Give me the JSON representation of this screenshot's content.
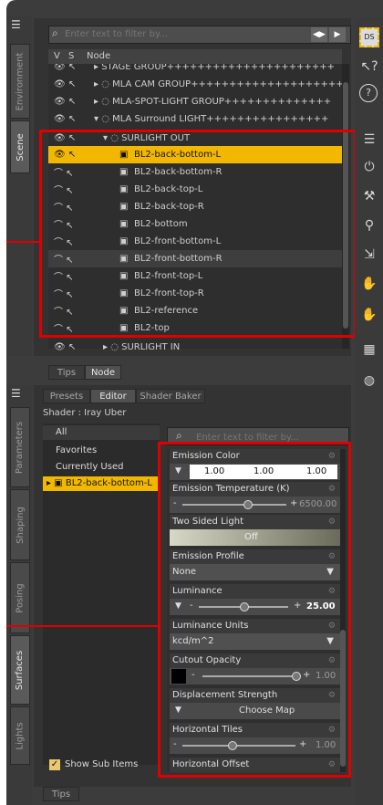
{
  "side_tabs_top": [
    "Environment",
    "Scene"
  ],
  "side_tabs_bottom": [
    "Parameters",
    "Shaping",
    "Posing",
    "Surfaces",
    "Lights"
  ],
  "scene": {
    "filter_placeholder": "Enter text to filter by...",
    "col_v": "V",
    "col_s": "S",
    "col_node": "Node",
    "groups_above": [
      "STAGE GROUP++++++++++++++++++++++",
      "MLA CAM GROUP++++++++++++++++++++",
      "MLA-SPOT-LIGHT GROUP++++++++++++++",
      "MLA Surround LIGHT++++++++++++++++"
    ],
    "group_open": "SURLIGHT OUT",
    "items": [
      "BL2-back-bottom-L",
      "BL2-back-bottom-R",
      "BL2-back-top-L",
      "BL2-back-top-R",
      "BL2-bottom",
      "BL2-front-bottom-L",
      "BL2-front-bottom-R",
      "BL2-front-top-L",
      "BL2-front-top-R",
      "BL2-reference",
      "BL2-top"
    ],
    "group_below": "SURLIGHT IN",
    "bottom_tabs": [
      "Tips",
      "Node"
    ]
  },
  "surfaces": {
    "tabs": [
      "Presets",
      "Editor",
      "Shader Baker"
    ],
    "shader": "Shader : Iray Uber",
    "left_list": [
      "All",
      "Favorites",
      "Currently Used",
      "BL2-back-bottom-L"
    ],
    "filter_placeholder": "Enter text to filter by...",
    "show_sub_items": "Show Sub Items",
    "bottom_tab": "Tips",
    "props": {
      "emission_color": "Emission Color",
      "emission_color_values": [
        "1.00",
        "1.00",
        "1.00"
      ],
      "emission_temp": "Emission Temperature (K)",
      "emission_temp_value": "6500.00",
      "emission_temp_fraction": 0.62,
      "two_sided": "Two Sided Light",
      "two_sided_value": "Off",
      "emission_profile": "Emission Profile",
      "emission_profile_value": "None",
      "luminance": "Luminance",
      "luminance_value": "25.00",
      "luminance_fraction": 0.5,
      "luminance_units": "Luminance Units",
      "luminance_units_value": "kcd/m^2",
      "cutout_opacity": "Cutout Opacity",
      "cutout_opacity_value": "1.00",
      "displacement_strength": "Displacement Strength",
      "choose_map": "Choose Map",
      "horizontal_tiles": "Horizontal Tiles",
      "horizontal_tiles_value": "1.00",
      "horizontal_offset": "Horizontal Offset"
    }
  },
  "right_toolbar": {
    "ds_label": "DS",
    "help": "?"
  },
  "colors": {
    "highlight": "#f2b800",
    "red": "#e00000",
    "bg": "#3c3c3c",
    "panel": "#2b2b2b"
  }
}
